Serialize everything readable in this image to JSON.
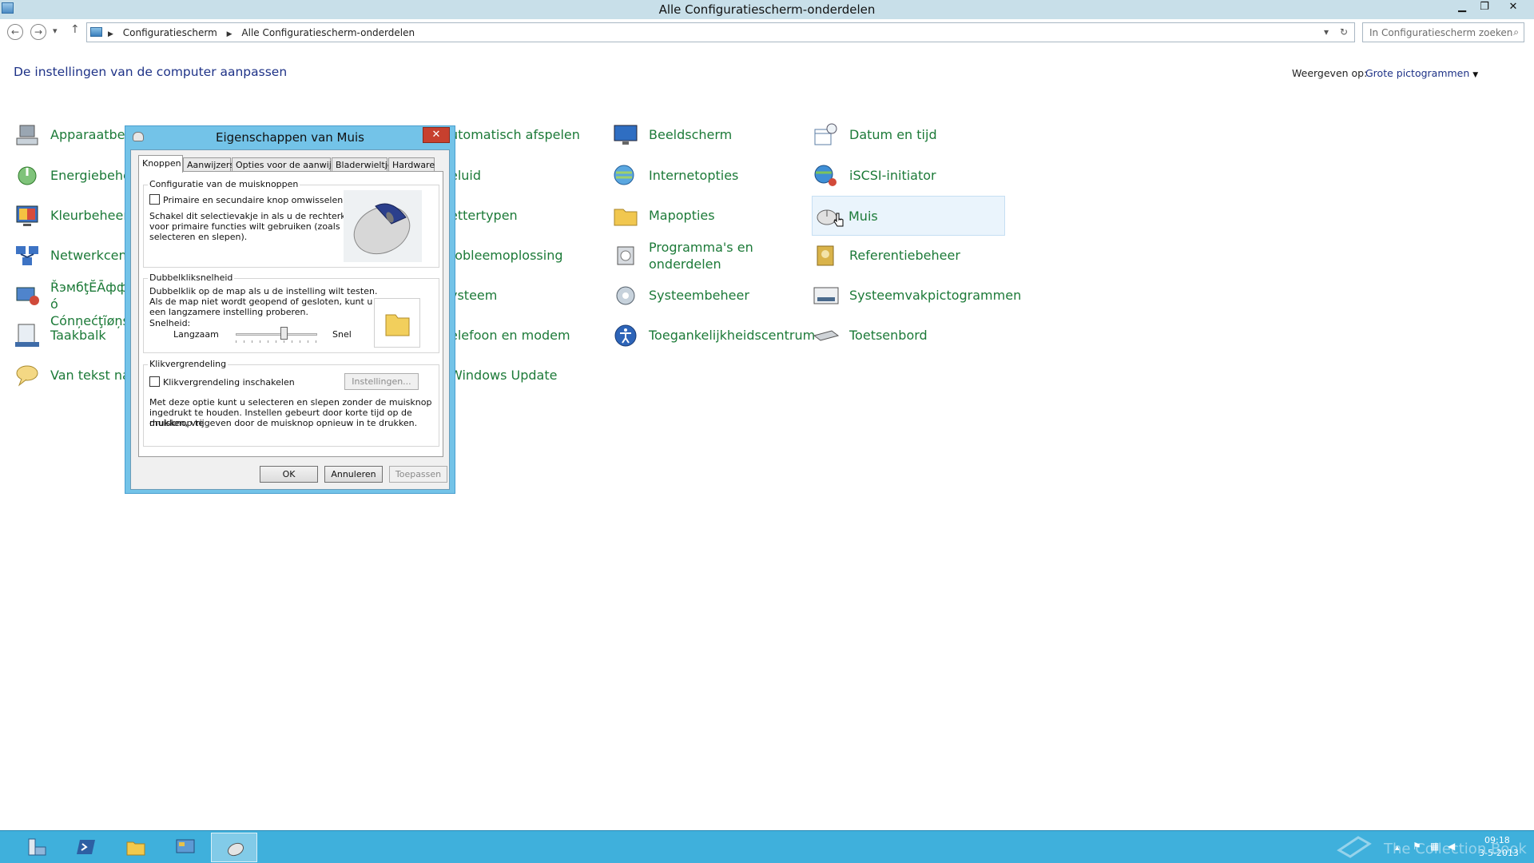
{
  "window": {
    "title": "Alle Configuratiescherm-onderdelen",
    "minimize_glyph": "▁",
    "restore_glyph": "❐",
    "close_glyph": "✕"
  },
  "address": {
    "crumb1": "Configuratiescherm",
    "crumb2": "Alle Configuratiescherm-onderdelen",
    "search_placeholder": "In Configuratiescherm zoeken"
  },
  "header": {
    "heading": "De instellingen van de computer aanpassen",
    "view_label": "Weergeven op:",
    "view_value": "Grote pictogrammen"
  },
  "items": {
    "col1": [
      "Apparaatbeheer",
      "Energiebeheer",
      "Kleurbeheer",
      "Netwerkcentr",
      "ŘэмбţĔĀфф ó Cónņеćţĩøņѕ",
      "Taakbalk",
      "Van tekst naa"
    ],
    "col2": [
      "utomatisch afspelen",
      "eluid",
      "ettertypen",
      "robleemoplossing",
      "ysteem",
      "elefoon en modem",
      "Windows Update"
    ],
    "col3": [
      "Beeldscherm",
      "Internetopties",
      "Mapopties",
      "Programma's en onderdelen",
      "Systeembeheer",
      "Toegankelijkheidscentrum"
    ],
    "col4": [
      "Datum en tijd",
      "iSCSI-initiator",
      "Muis",
      "Referentiebeheer",
      "Systeemvakpictogrammen",
      "Toetsenbord"
    ]
  },
  "dialog": {
    "title": "Eigenschappen van Muis",
    "tabs": [
      "Knoppen",
      "Aanwijzers",
      "Opties voor de aanwijzer",
      "Bladerwieltje",
      "Hardware"
    ],
    "buttons_group": {
      "title": "Configuratie van de muisknoppen",
      "checkbox_label": "Primaire en secundaire knop omwisselen",
      "description": [
        "Schakel dit selectievakje in als u de rechterknop",
        "voor primaire functies wilt gebruiken (zoals",
        "selecteren en slepen)."
      ]
    },
    "dblclick_group": {
      "title": "Dubbelkliksnelheid",
      "description": [
        "Dubbelklik op de map als u de instelling wilt testen.",
        "Als de map niet wordt geopend of gesloten, kunt u",
        "een langzamere instelling proberen."
      ],
      "speed_label": "Snelheid:",
      "slow_label": "Langzaam",
      "fast_label": "Snel",
      "slider_value": 0.6
    },
    "clicklock_group": {
      "title": "Klikvergrendeling",
      "checkbox_label": "Klikvergrendeling inschakelen",
      "settings_button": "Instellingen...",
      "description": [
        "Met deze optie kunt u selecteren en slepen zonder de muisknop",
        "ingedrukt te houden. Instellen gebeurt door korte tijd op de muisknop te",
        "drukken, vrijgeven door de muisknop opnieuw in te drukken."
      ]
    },
    "ok": "OK",
    "cancel": "Annuleren",
    "apply": "Toepassen"
  },
  "taskbar": {
    "time": "09:18",
    "date": "3-5-2013",
    "watermark": "The Collection Book"
  },
  "colors": {
    "titlebar": "#c8dfe9",
    "link_green": "#1c7a38",
    "dialog_frame": "#73c3e8",
    "taskbar": "#3fb0dc"
  }
}
